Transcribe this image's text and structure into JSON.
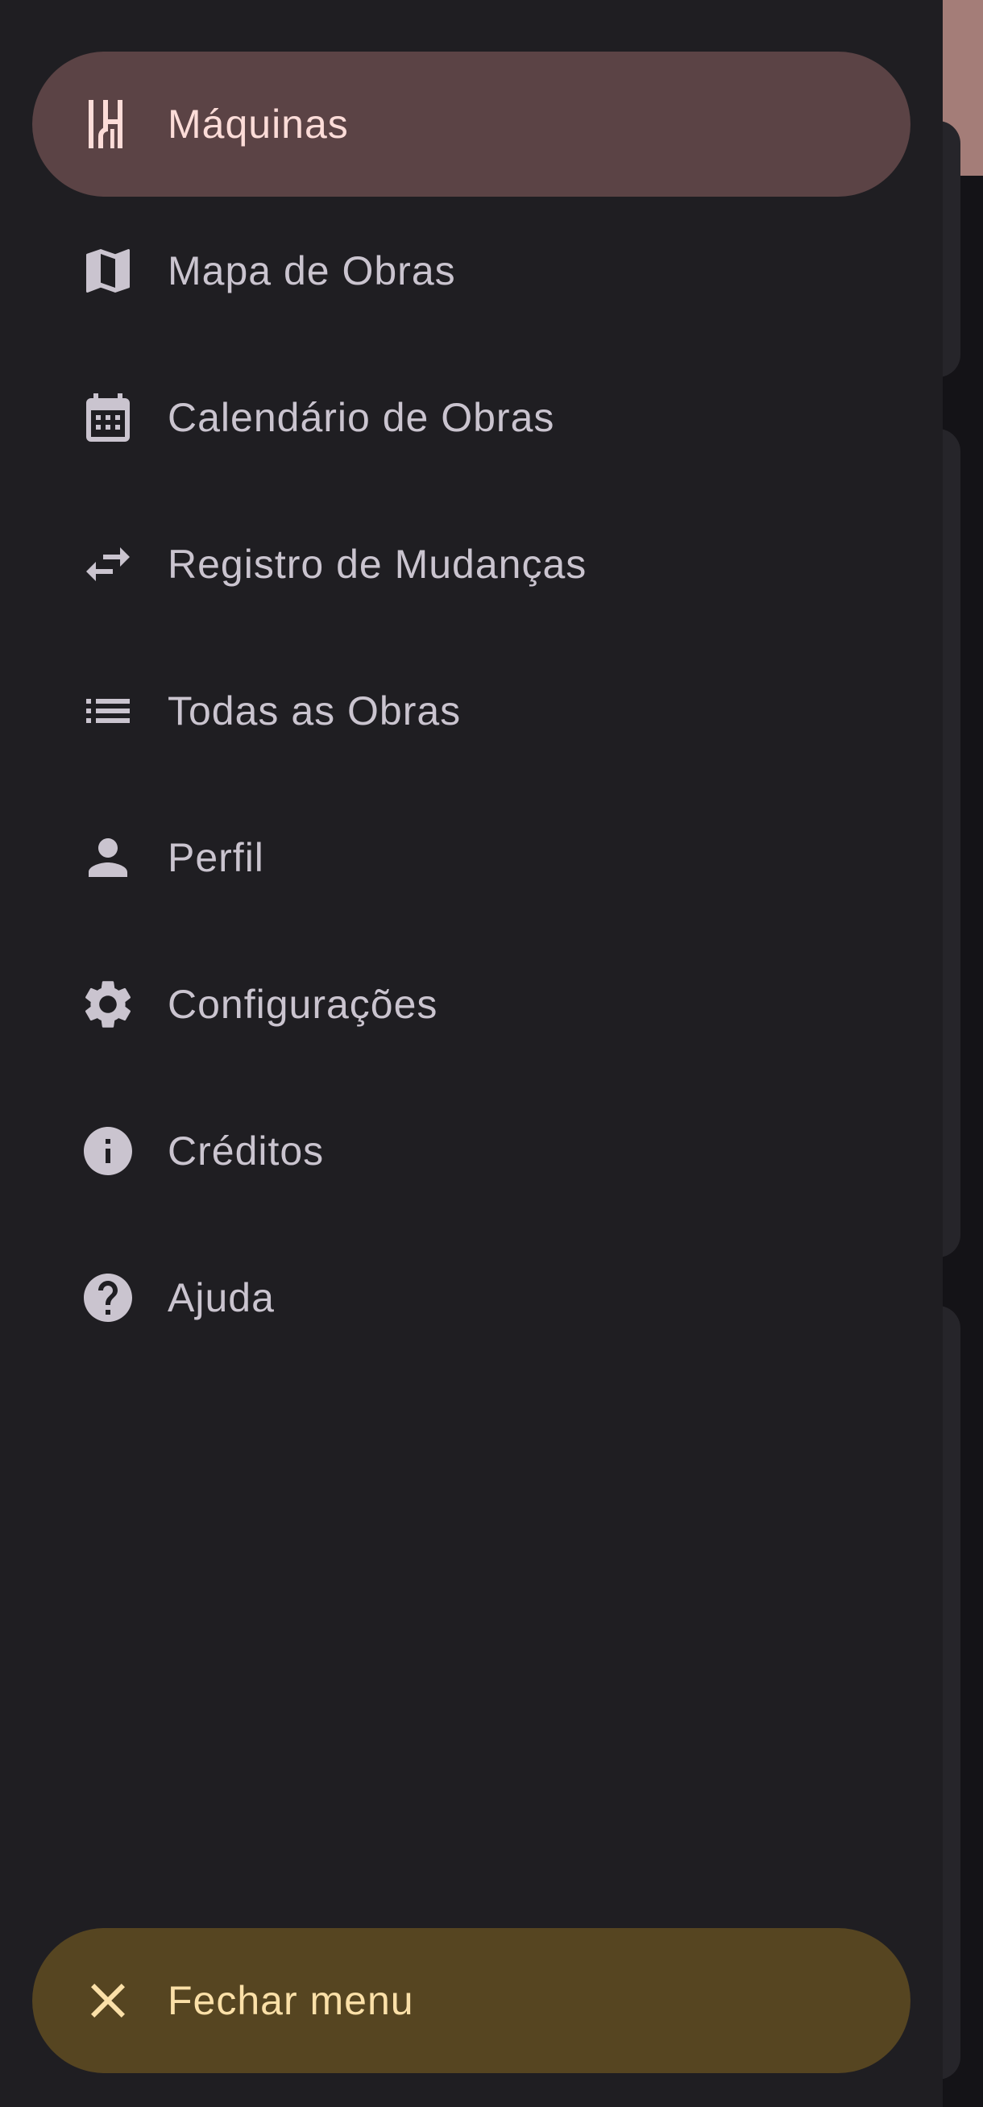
{
  "colors": {
    "drawer_bg": "#1f1e22",
    "active_bg": "#5b4345",
    "active_text": "#fcdcd8",
    "item_text": "#cac4cf",
    "close_bg": "#564521",
    "close_text": "#fbe0a8"
  },
  "nav": {
    "items": [
      {
        "label": "Máquinas",
        "icon": "machines-icon",
        "active": true
      },
      {
        "label": "Mapa de Obras",
        "icon": "map-icon",
        "active": false
      },
      {
        "label": "Calendário de Obras",
        "icon": "calendar-icon",
        "active": false
      },
      {
        "label": "Registro de Mudanças",
        "icon": "swap-arrows-icon",
        "active": false
      },
      {
        "label": "Todas as Obras",
        "icon": "list-icon",
        "active": false
      },
      {
        "label": "Perfil",
        "icon": "person-icon",
        "active": false
      },
      {
        "label": "Configurações",
        "icon": "gear-icon",
        "active": false
      },
      {
        "label": "Créditos",
        "icon": "info-icon",
        "active": false
      },
      {
        "label": "Ajuda",
        "icon": "help-icon",
        "active": false
      }
    ]
  },
  "close": {
    "label": "Fechar menu",
    "icon": "close-icon"
  }
}
